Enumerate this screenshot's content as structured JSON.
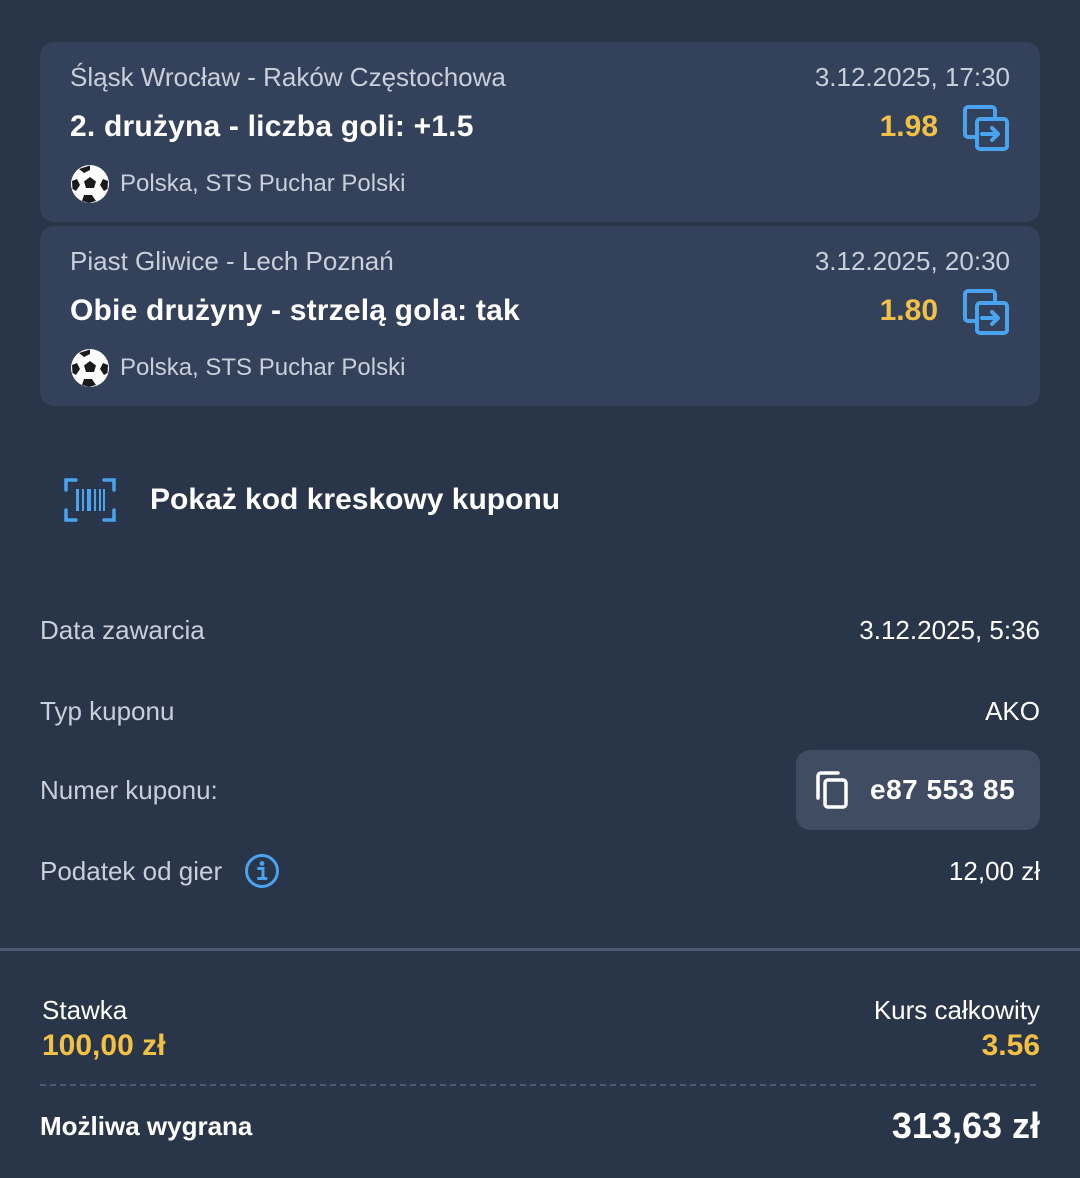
{
  "bets": [
    {
      "match": "Śląsk Wrocław - Raków Częstochowa",
      "datetime": "3.12.2025, 17:30",
      "market": "2. drużyna - liczba goli: +1.5",
      "odds": "1.98",
      "league": "Polska, STS Puchar Polski",
      "sport_icon": "soccer-ball-icon",
      "action_icon": "swap-bet-icon"
    },
    {
      "match": "Piast Gliwice - Lech Poznań",
      "datetime": "3.12.2025, 20:30",
      "market": "Obie drużyny - strzelą gola: tak",
      "odds": "1.80",
      "league": "Polska, STS Puchar Polski",
      "sport_icon": "soccer-ball-icon",
      "action_icon": "swap-bet-icon"
    }
  ],
  "barcode": {
    "label": "Pokaż kod kreskowy kuponu",
    "icon": "barcode-scan-icon"
  },
  "details": {
    "date_label": "Data zawarcia",
    "date_value": "3.12.2025, 5:36",
    "type_label": "Typ kuponu",
    "type_value": "AKO",
    "number_label": "Numer kuponu:",
    "number_value": "e87 553 85",
    "tax_label": "Podatek od gier",
    "tax_value": "12,00 zł"
  },
  "summary": {
    "stake_label": "Stawka",
    "stake_value": "100,00 zł",
    "total_odds_label": "Kurs całkowity",
    "total_odds_value": "3.56",
    "win_label": "Możliwa wygrana",
    "win_value": "313,63 zł"
  },
  "colors": {
    "background": "#293548",
    "card": "#33415a",
    "accent_yellow": "#f2c044",
    "accent_blue": "#4aa3ee"
  }
}
